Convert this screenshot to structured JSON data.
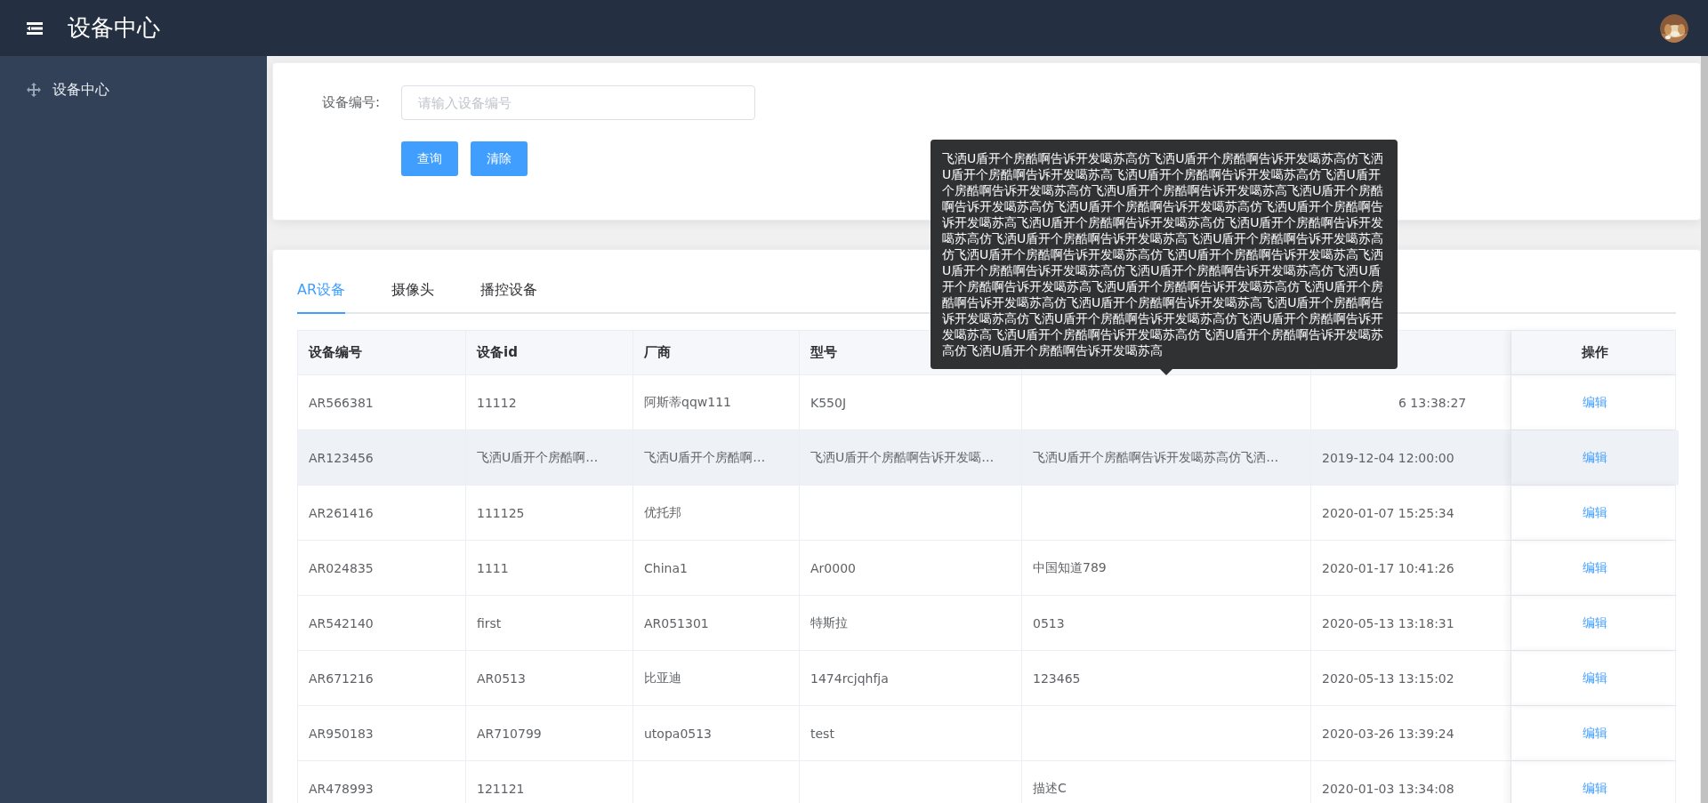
{
  "header": {
    "title": "设备中心"
  },
  "sidebar": {
    "items": [
      {
        "label": "设备中心",
        "selected": false
      }
    ]
  },
  "search": {
    "label": "设备编号:",
    "placeholder": "请输入设备编号",
    "buttons": [
      "查询",
      "清除"
    ]
  },
  "tabs": [
    {
      "label": "AR设备",
      "selected": true
    },
    {
      "label": "摄像头",
      "selected": false
    },
    {
      "label": "播控设备",
      "selected": false
    }
  ],
  "table": {
    "columns": [
      "设备编号",
      "设备id",
      "厂商",
      "型号"
    ],
    "action_column": "操作",
    "rows": [
      {
        "hovered": false,
        "cells": [
          "AR566381",
          "11112",
          "阿斯蒂qqw111",
          "K550J",
          null,
          "6 13:38:27"
        ],
        "action": "编辑"
      },
      {
        "hovered": true,
        "cells": [
          "AR123456",
          "飞洒U盾开个房酷啊…",
          "飞洒U盾开个房酷啊…",
          "飞洒U盾开个房酷啊告诉开发噶…",
          "飞洒U盾开个房酷啊告诉开发噶苏高仿飞洒…",
          "2019-12-04 12:00:00"
        ],
        "action": "编辑"
      },
      {
        "hovered": false,
        "cells": [
          "AR261416",
          "111125",
          "优托邦",
          null,
          null,
          "2020-01-07 15:25:34"
        ],
        "action": "编辑"
      },
      {
        "hovered": false,
        "cells": [
          "AR024835",
          "1111",
          "China1",
          "Ar0000",
          "中国知道789",
          "2020-01-17 10:41:26"
        ],
        "action": "编辑"
      },
      {
        "hovered": false,
        "cells": [
          "AR542140",
          "first",
          "AR051301",
          "特斯拉",
          "0513",
          "2020-05-13 13:18:31"
        ],
        "action": "编辑"
      },
      {
        "hovered": false,
        "cells": [
          "AR671216",
          "AR0513",
          "比亚迪",
          "1474rcjqhfja",
          "123465",
          "2020-05-13 13:15:02"
        ],
        "action": "编辑"
      },
      {
        "hovered": false,
        "cells": [
          "AR950183",
          "AR710799",
          "utopa0513",
          "test",
          null,
          "2020-03-26 13:39:24"
        ],
        "action": "编辑"
      },
      {
        "hovered": false,
        "cells": [
          "AR478993",
          "121121",
          null,
          null,
          "描述C",
          "2020-01-03 13:34:08"
        ],
        "action": "编辑"
      }
    ]
  },
  "tooltip": {
    "text": "飞洒U盾开个房酷啊告诉开发噶苏高仿飞洒U盾开个房酷啊告诉开发噶苏高仿飞洒U盾开个房酷啊告诉开发噶苏高飞洒U盾开个房酷啊告诉开发噶苏高仿飞洒U盾开个房酷啊告诉开发噶苏高仿飞洒U盾开个房酷啊告诉开发噶苏高飞洒U盾开个房酷啊告诉开发噶苏高仿飞洒U盾开个房酷啊告诉开发噶苏高仿飞洒U盾开个房酷啊告诉开发噶苏高飞洒U盾开个房酷啊告诉开发噶苏高仿飞洒U盾开个房酷啊告诉开发噶苏高仿飞洒U盾开个房酷啊告诉开发噶苏高飞洒U盾开个房酷啊告诉开发噶苏高仿飞洒U盾开个房酷啊告诉开发噶苏高仿飞洒U盾开个房酷啊告诉开发噶苏高飞洒U盾开个房酷啊告诉开发噶苏高仿飞洒U盾开个房酷啊告诉开发噶苏高仿飞洒U盾开个房酷啊告诉开发噶苏高飞洒U盾开个房酷啊告诉开发噶苏高仿飞洒U盾开个房酷啊告诉开发噶苏高仿飞洒U盾开个房酷啊告诉开发噶苏高飞洒U盾开个房酷啊告诉开发噶苏高仿飞洒U盾开个房酷啊告诉开发噶苏高仿飞洒U盾开个房酷啊告诉开发噶苏高飞洒U盾开个房酷啊告诉开发噶苏高仿飞洒U盾开个房酷啊告诉开发噶苏高仿飞洒U盾开个房酷啊告诉开发噶苏高"
  }
}
